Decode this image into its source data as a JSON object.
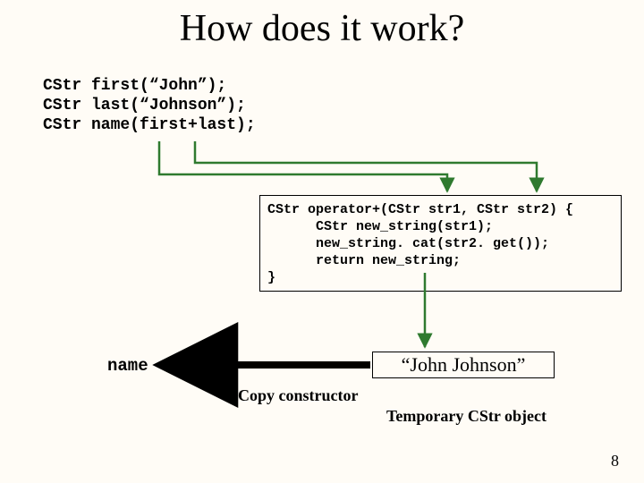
{
  "title": "How does it work?",
  "decl": {
    "line1": "CStr first(“John”);",
    "line2": "CStr last(“Johnson”);",
    "line3": "CStr name(first+last);"
  },
  "fn": {
    "sig_open": "CStr operator+(CStr str1, CStr str2) {",
    "body1": "      CStr new_string(str1);",
    "body2": "      new_string. cat(str2. get());",
    "body3": "      return new_string;",
    "close": "}"
  },
  "result": "“John Johnson”",
  "name_label": "name",
  "copy_ctor": "Copy constructor",
  "temp_obj": "Temporary CStr object",
  "page": "8"
}
